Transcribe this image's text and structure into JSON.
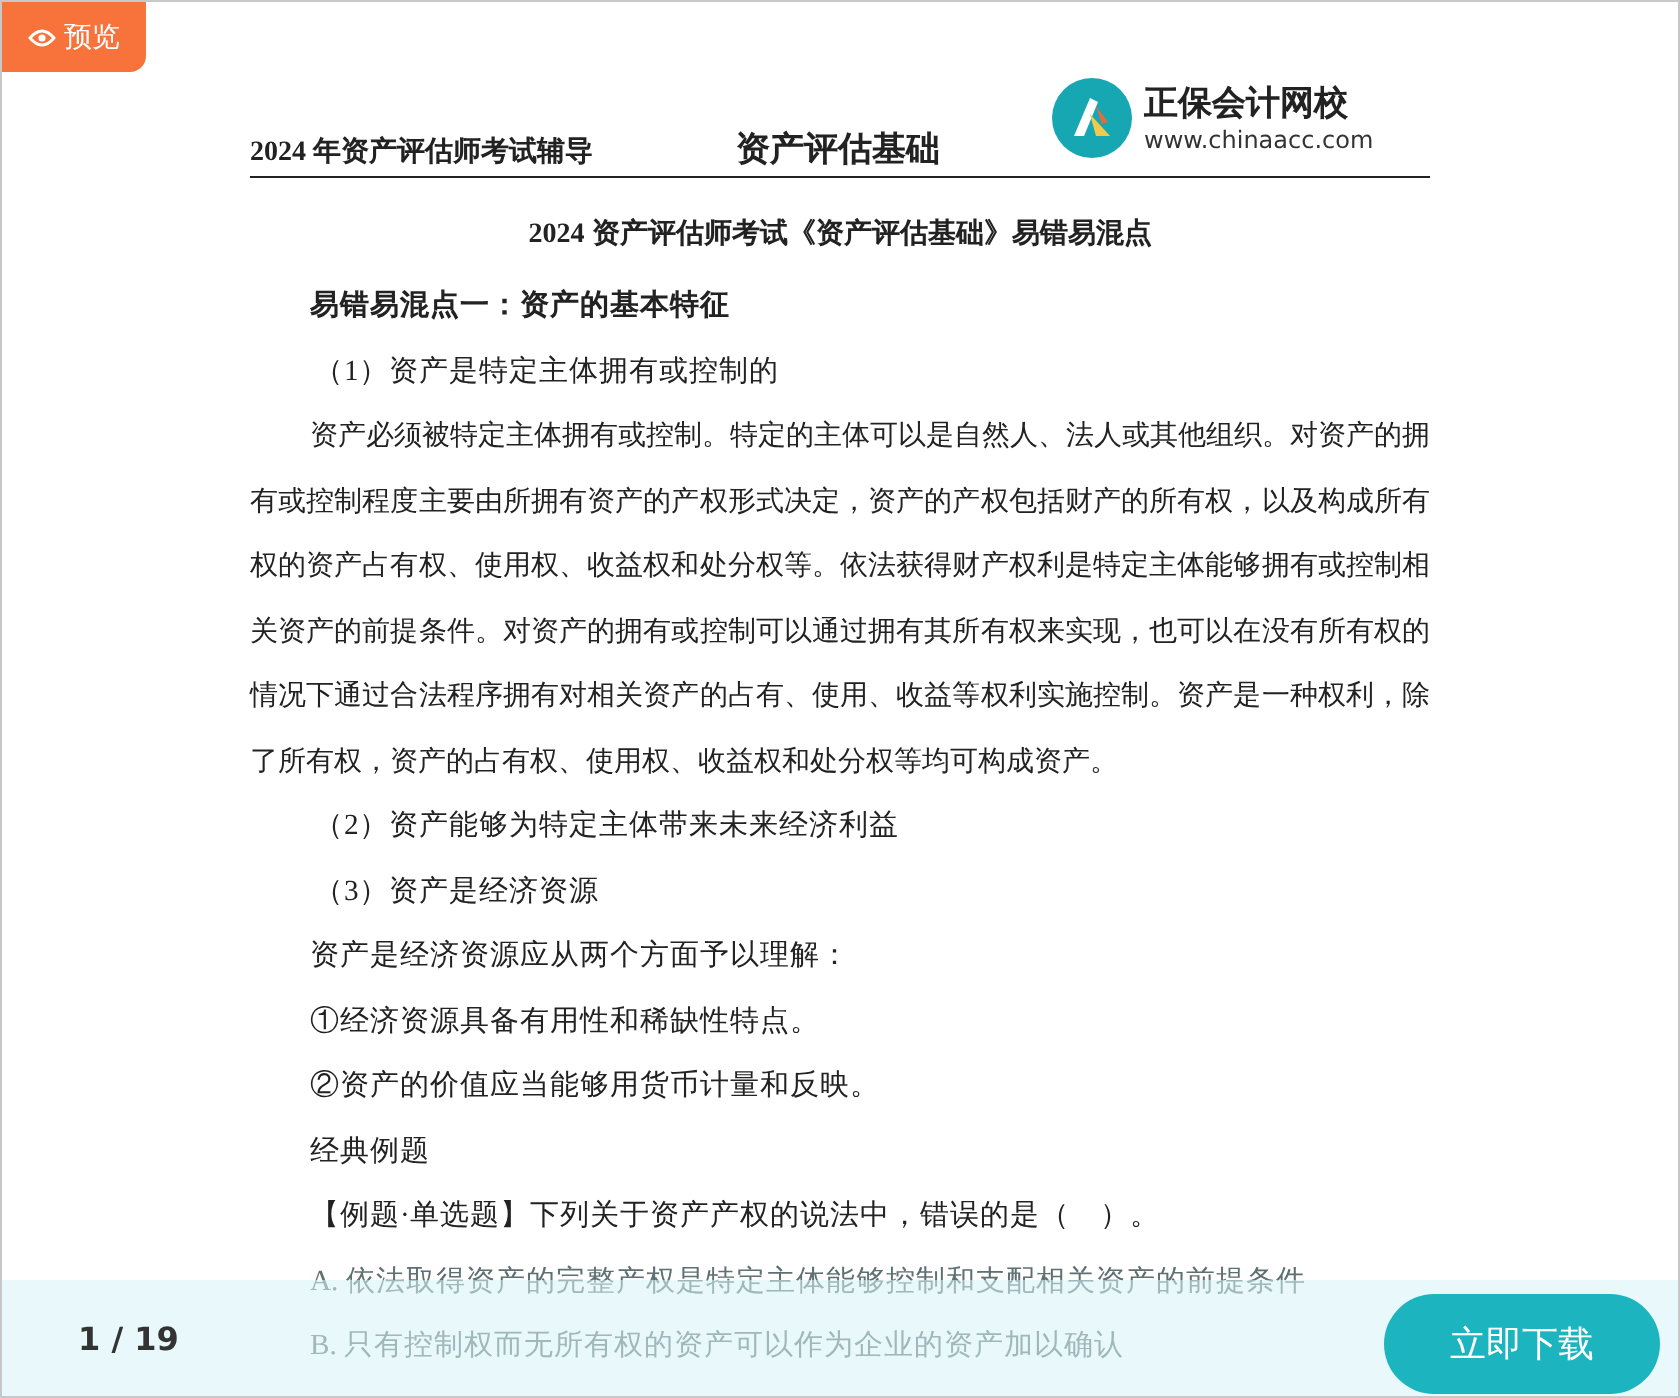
{
  "badge": {
    "label": "预览"
  },
  "header": {
    "left": "2024 年资产评估师考试辅导",
    "center": "资产评估基础",
    "logo_name": "正保会计网校",
    "logo_url": "www.chinaacc.com"
  },
  "document": {
    "title": "2024 资产评估师考试《资产评估基础》易错易混点",
    "blocks": [
      {
        "kind": "heading",
        "text": "易错易混点一：资产的基本特征"
      },
      {
        "kind": "item",
        "text": "（1）资产是特定主体拥有或控制的"
      },
      {
        "kind": "paragraph",
        "text": "资产必须被特定主体拥有或控制。特定的主体可以是自然人、法人或其他组织。对资产的拥有或控制程度主要由所拥有资产的产权形式决定，资产的产权包括财产的所有权，以及构成所有权的资产占有权、使用权、收益权和处分权等。依法获得财产权利是特定主体能够拥有或控制相关资产的前提条件。对资产的拥有或控制可以通过拥有其所有权来实现，也可以在没有所有权的情况下通过合法程序拥有对相关资产的占有、使用、收益等权利实施控制。资产是一种权利，除了所有权，资产的占有权、使用权、收益权和处分权等均可构成资产。"
      },
      {
        "kind": "item",
        "text": "（2）资产能够为特定主体带来未来经济利益"
      },
      {
        "kind": "item",
        "text": "（3）资产是经济资源"
      },
      {
        "kind": "line",
        "text": "资产是经济资源应从两个方面予以理解："
      },
      {
        "kind": "line",
        "text": "①经济资源具备有用性和稀缺性特点。"
      },
      {
        "kind": "line",
        "text": "②资产的价值应当能够用货币计量和反映。"
      },
      {
        "kind": "line",
        "text": "经典例题"
      },
      {
        "kind": "line",
        "text": "【例题·单选题】下列关于资产产权的说法中，错误的是（　）。"
      },
      {
        "kind": "option",
        "text": "A. 依法取得资产的完整产权是特定主体能够控制和支配相关资产的前提条件"
      },
      {
        "kind": "option",
        "text": "B. 只有控制权而无所有权的资产可以作为企业的资产加以确认"
      }
    ]
  },
  "footer": {
    "page": "1 / 19",
    "download": "立即下载"
  }
}
